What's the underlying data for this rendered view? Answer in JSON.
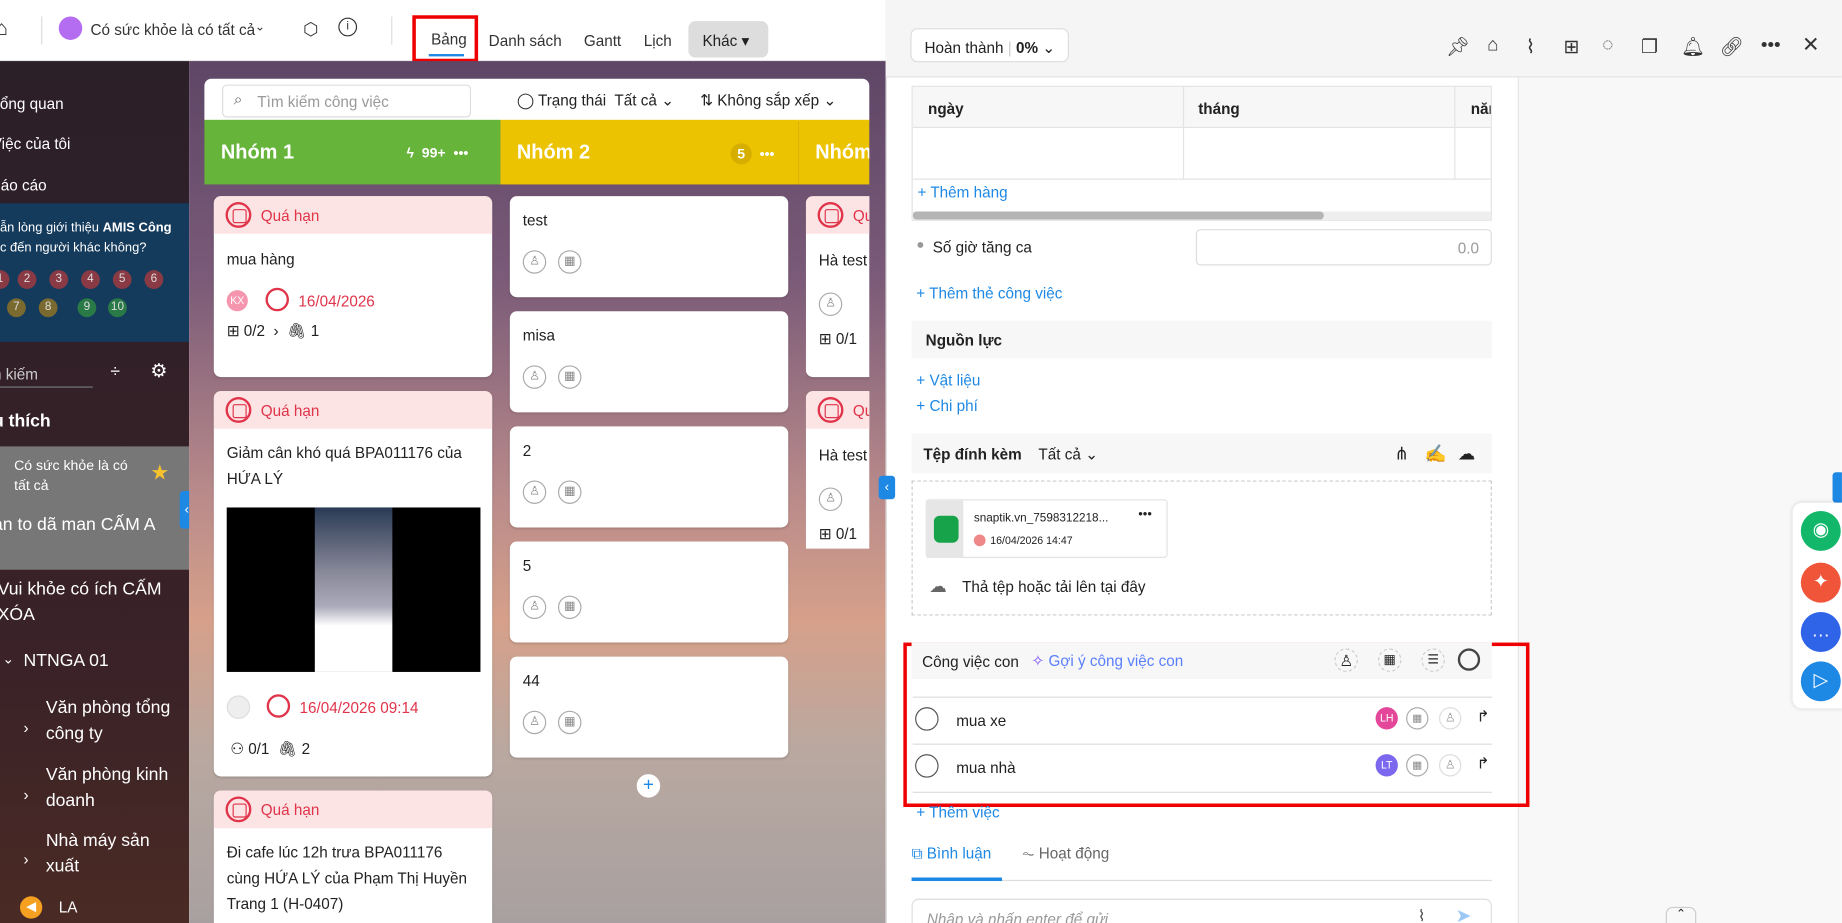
{
  "topbar": {
    "project": "Có sức khỏe là có tất cả",
    "tabs": [
      "Bảng",
      "Danh sách",
      "Gantt",
      "Lịch",
      "Khác"
    ]
  },
  "sidebar": {
    "nav": [
      "Tổng quan",
      "Việc của tôi",
      "Báo cáo"
    ],
    "promo_line1": "ẫn lòng giới thiệu",
    "promo_brand": "AMIS Công",
    "promo_line2": "c đến người khác không?",
    "ratings": [
      "1",
      "2",
      "3",
      "4",
      "5",
      "6",
      "7",
      "8",
      "9",
      "10"
    ],
    "search_placeholder": "n kiếm",
    "favorites": "u thích",
    "items": [
      "Có sức khỏe là có tất cả",
      "án to dã man CẤM A",
      "Vui khỏe có ích CẤM XÓA",
      "NTNGA 01",
      "Văn phòng tổng công ty",
      "Văn phòng kinh doanh",
      "Nhà máy sản xuất",
      "LA"
    ]
  },
  "board": {
    "search_placeholder": "Tìm kiếm công việc",
    "status_label": "Trạng thái",
    "status_value": "Tất cả",
    "sort_label": "Không sắp xếp",
    "groups": [
      {
        "name": "Nhóm 1",
        "count": "99+",
        "color": "#66b43a"
      },
      {
        "name": "Nhóm 2",
        "count": "5",
        "color": "#ecc300"
      },
      {
        "name": "Nhóm",
        "color": "#ecc300"
      }
    ],
    "overdue": "Quá hạn",
    "g1": [
      {
        "title": "mua hàng",
        "avatar": "KX",
        "date": "16/04/2026",
        "subtasks": "0/2",
        "attachments": "1"
      },
      {
        "title": "Giảm cân khó quá BPA011176 của HỨA LÝ",
        "date": "16/04/2026 09:14",
        "subtasks": "0/1",
        "attachments": "2"
      },
      {
        "title": "Đi cafe lúc 12h trưa BPA011176 cùng HỨA LÝ của Phạm Thị Huyền Trang 1 (H-0407)"
      }
    ],
    "g2": [
      "test",
      "misa",
      "2",
      "5",
      "44"
    ],
    "g3": [
      {
        "title": "Hà test",
        "subtasks": "0/1"
      },
      {
        "title": "Hà test",
        "subtasks": "0/1"
      }
    ]
  },
  "panel": {
    "progress_label": "Hoàn thành",
    "progress_value": "0%",
    "table_cols": [
      "ngày",
      "tháng",
      "năm"
    ],
    "add_row": "Thêm hàng",
    "overtime_label": "Số giờ tăng ca",
    "overtime_value": "0.0",
    "add_tag": "Thêm thẻ công việc",
    "resources": "Nguồn lực",
    "materials": "Vật liệu",
    "costs": "Chi phí",
    "attach_title": "Tệp đính kèm",
    "attach_filter": "Tất cả",
    "file_name": "snaptik.vn_7598312218...",
    "file_date": "16/04/2026 14:47",
    "drop_text": "Thả tệp hoặc tải lên tại đây",
    "subtasks_title": "Công việc con",
    "suggest": "Gợi ý công việc con",
    "subtasks": [
      {
        "name": "mua xe",
        "avatar": "LH",
        "color": "#e4479a"
      },
      {
        "name": "mua nhà",
        "avatar": "LT",
        "color": "#7b68ee"
      }
    ],
    "add_task": "Thêm việc",
    "tab_comment": "Bình luận",
    "tab_activity": "Hoạt động",
    "comment_placeholder": "Nhập và nhấn enter để gửi"
  }
}
